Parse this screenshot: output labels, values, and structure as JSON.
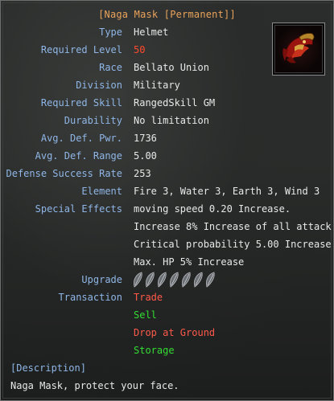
{
  "item": {
    "title": "[Naga Mask [Permanent]]",
    "icon": "naga-mask-helmet-icon",
    "stats": [
      {
        "label": "Type",
        "value": "Helmet"
      },
      {
        "label": "Required Level",
        "value": "50"
      },
      {
        "label": "Race",
        "value": "Bellato Union"
      },
      {
        "label": "Division",
        "value": "Military"
      },
      {
        "label": "Required Skill",
        "value": "RangedSkill GM"
      },
      {
        "label": "Durability",
        "value": "No limitation"
      },
      {
        "label": "Avg. Def. Pwr.",
        "value": "1736"
      },
      {
        "label": "Avg. Def. Range",
        "value": "5.00"
      },
      {
        "label": "Defense Success Rate",
        "value": "253"
      },
      {
        "label": "Element",
        "value": "Fire 3, Water 3, Earth 3, Wind 3"
      }
    ],
    "special_effects": {
      "label": "Special Effects",
      "lines": [
        "moving speed 0.20 Increase.",
        "Increase 8% Increase of all attack",
        "Critical probability 5.00 Increase",
        "Max. HP 5% Increase"
      ]
    },
    "upgrade": {
      "label": "Upgrade",
      "total_slots": 7,
      "filled_slots": 0,
      "slot_icon": "empty-talic-slot-icon"
    },
    "transaction": {
      "label": "Transaction",
      "options": [
        "Trade",
        "Sell",
        "Drop at Ground",
        "Storage"
      ]
    },
    "description": {
      "header": "[Description]",
      "text": "Naga Mask, protect your face."
    }
  },
  "colors": {
    "title": "#e9a35c",
    "label": "#8fb6e6",
    "value": "#e8e8e8",
    "required_level": "#ff4a2c",
    "restricted": "#ff5a4a",
    "allowed": "#33dd33",
    "background": "#2a2c2b",
    "border": "#6e6e6e"
  }
}
